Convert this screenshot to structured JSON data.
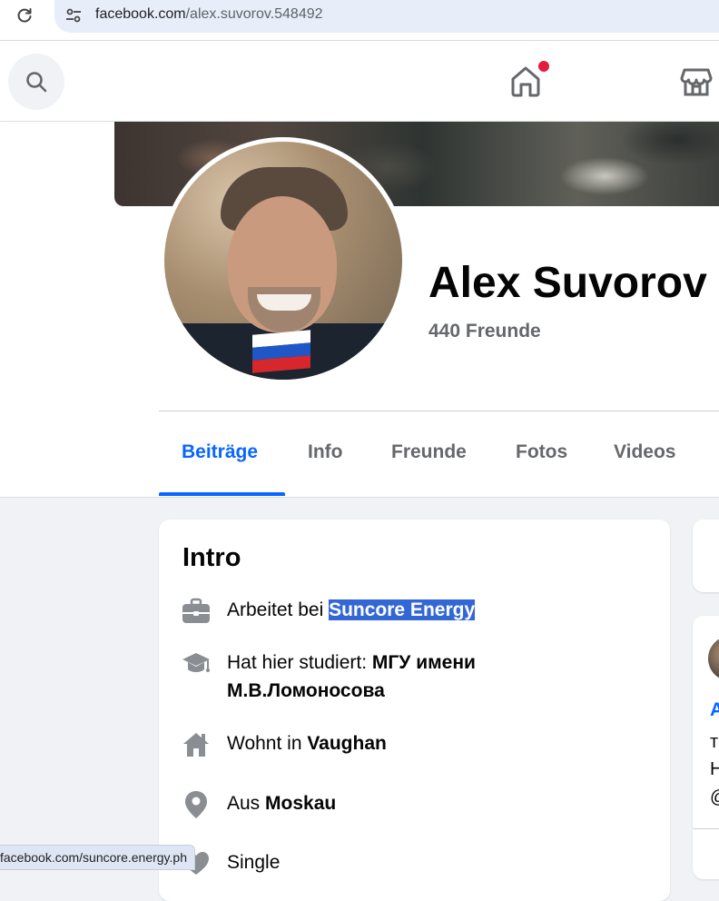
{
  "browser": {
    "url_domain": "facebook.com",
    "url_path": "/alex.suvorov.548492"
  },
  "nav": {
    "icons": [
      "search-icon",
      "home-icon",
      "marketplace-icon"
    ],
    "colors": {
      "notification": "#e41e3f",
      "accent": "#0866ff"
    }
  },
  "profile": {
    "name": "Alex Suvorov",
    "friends": "440 Freunde"
  },
  "tabs": [
    {
      "label": "Beiträge",
      "active": true
    },
    {
      "label": "Info",
      "active": false
    },
    {
      "label": "Freunde",
      "active": false
    },
    {
      "label": "Fotos",
      "active": false
    },
    {
      "label": "Videos",
      "active": false
    }
  ],
  "intro": {
    "title": "Intro",
    "work_prefix": "Arbeitet bei ",
    "work_value": "Suncore Energy",
    "study_prefix": "Hat hier studiert: ",
    "study_value": "МГУ имени М.В.Ломоносова",
    "lives_prefix": "Wohnt in ",
    "lives_value": "Vaughan",
    "from_prefix": "Aus ",
    "from_value": "Moskau",
    "relationship": "Single"
  },
  "right_column": {
    "post_author_initial": "A",
    "post_lines": [
      "т",
      "Н",
      "@"
    ]
  },
  "status_bar": {
    "link": "facebook.com/suncore.energy.ph"
  }
}
